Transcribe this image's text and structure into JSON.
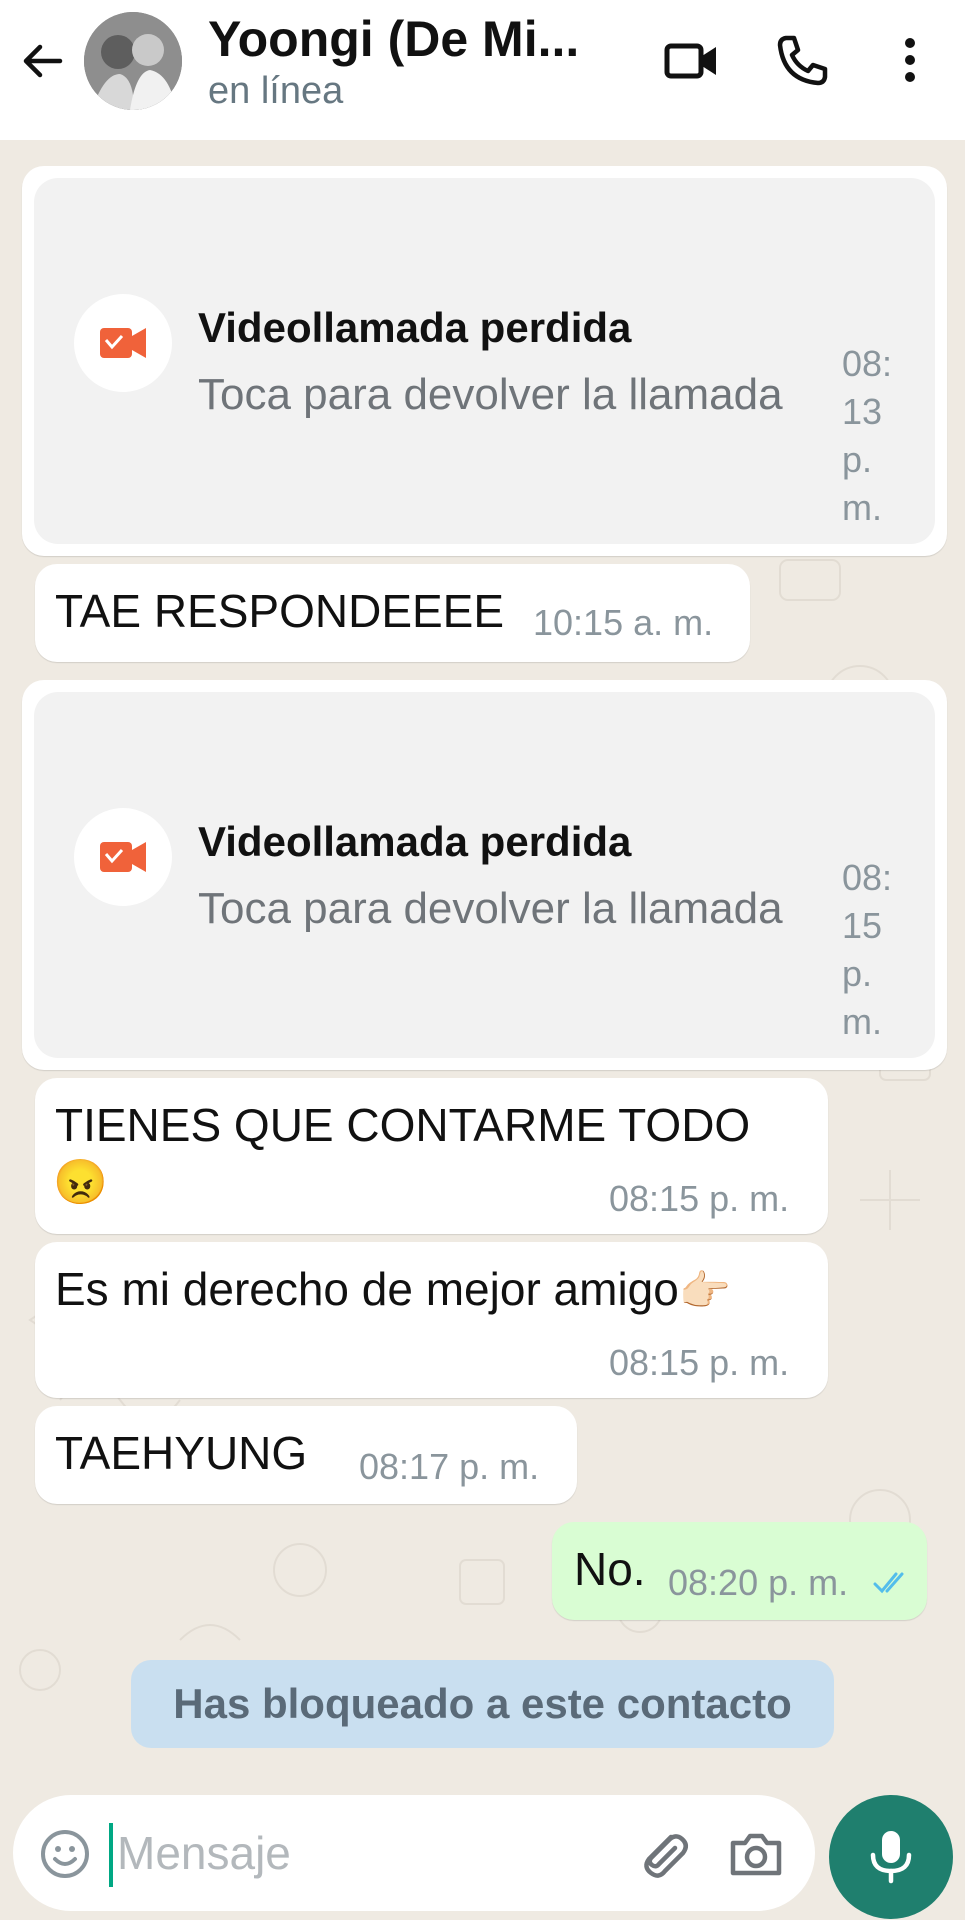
{
  "header": {
    "contact_name": "Yoongi (De Mi...",
    "status": "en línea"
  },
  "messages": [
    {
      "type": "missed_call",
      "title": "Videollamada perdida",
      "subtitle": "Toca para devolver la llamada",
      "time_lines": [
        "08:",
        "13",
        "p.",
        "m."
      ]
    },
    {
      "type": "text",
      "text": "TAE RESPONDEEEE",
      "time": "10:15 a. m."
    },
    {
      "type": "missed_call",
      "title": "Videollamada perdida",
      "subtitle": "Toca para devolver la llamada",
      "time_lines": [
        "08:",
        "15",
        "p.",
        "m."
      ]
    },
    {
      "type": "text",
      "text": "TIENES QUE CONTARME TODO",
      "emoji": "😠",
      "time": "08:15 p. m."
    },
    {
      "type": "text",
      "text": "Es mi derecho de mejor amigo",
      "emoji": "👉🏻",
      "time": "08:15 p. m."
    },
    {
      "type": "text",
      "text": "TAEHYUNG",
      "time": "08:17 p. m."
    },
    {
      "type": "outgoing",
      "text": "No.",
      "time": "08:20 p. m.",
      "status": "read"
    }
  ],
  "system_notice": "Has bloqueado a este contacto",
  "composer": {
    "placeholder": "Mensaje"
  },
  "colors": {
    "chat_bg": "#efeae2",
    "outgoing_bubble": "#d9fdd3",
    "missed_call_icon": "#f0623a",
    "mic_button": "#1f7f6e",
    "read_ticks": "#53bdeb",
    "notice_bg": "#c9dff0"
  },
  "icons": [
    "back-arrow-icon",
    "video-call-icon",
    "phone-icon",
    "more-vert-icon",
    "missed-video-call-icon",
    "read-receipt-icon",
    "emoji-icon",
    "attach-icon",
    "camera-icon",
    "mic-icon"
  ]
}
